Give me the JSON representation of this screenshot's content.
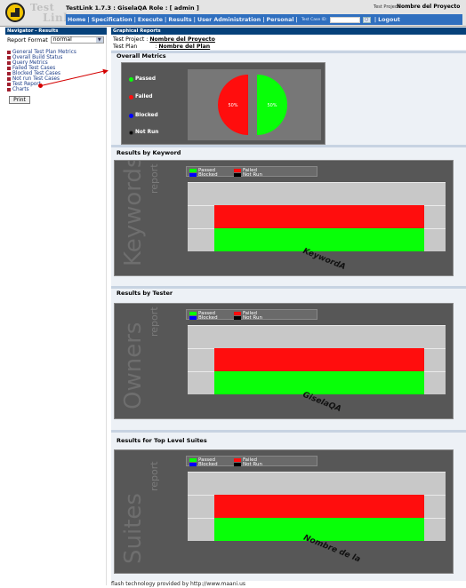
{
  "header": {
    "logo_line1": "Test",
    "logo_line2": "Link",
    "app_title": "TestLink 1.7.3 : GiselaQA Role : [ admin ]",
    "project_label": "Test Project",
    "project_value": "Nombre del Proyecto",
    "menu": [
      "Home",
      "Specification",
      "Execute",
      "Results",
      "User Administration",
      "Personal"
    ],
    "test_case_id_label": "Test Case ID:",
    "logout": "Logout"
  },
  "navigator": {
    "title": "Navigator - Results",
    "report_format_label": "Report Format",
    "report_format_value": "normal",
    "items": [
      "General Test Plan Metrics",
      "Overall Build Status",
      "Query Metrics",
      "Failed Test Cases",
      "Blocked Test Cases",
      "Not run Test Cases",
      "Test Report",
      "Charts"
    ],
    "print_label": "Print"
  },
  "main": {
    "title": "Graphical Reports",
    "test_project_label": "Test Project :",
    "test_project_value": "Nombre del Proyecto",
    "test_plan_label": "Test Plan",
    "test_plan_sep": ":",
    "test_plan_value": "Nombre del Plan",
    "overall_metrics_title": "Overall Metrics",
    "results_by_keyword_title": "Results by Keyword",
    "results_by_tester_title": "Results by Tester",
    "results_by_suite_title": "Results for Top Level Suites",
    "footer": "flash technology provided by http://www.maani.us"
  },
  "colors": {
    "passed": "#08ff08",
    "failed": "#ff0d0d",
    "blocked": "#0000ff",
    "not_run": "#000000",
    "nav_header": "#06417a"
  },
  "chart_data": [
    {
      "type": "pie",
      "legend": [
        "Passed",
        "Failed",
        "Blocked",
        "Not Run"
      ],
      "values": [
        50,
        50,
        0,
        0
      ],
      "labels": [
        "50%",
        "50%"
      ]
    },
    {
      "type": "bar",
      "watermark": "Keywords",
      "watermark_sub": "report",
      "legend": [
        "Passed",
        "Failed",
        "Blocked",
        "Not Run"
      ],
      "categories": [
        "KeywordA"
      ],
      "series": [
        {
          "name": "Passed",
          "values": [
            1
          ]
        },
        {
          "name": "Failed",
          "values": [
            1
          ]
        },
        {
          "name": "Blocked",
          "values": [
            0
          ]
        },
        {
          "name": "Not Run",
          "values": [
            0
          ]
        }
      ],
      "ylim": [
        0,
        3
      ]
    },
    {
      "type": "bar",
      "watermark": "Owners",
      "watermark_sub": "report",
      "legend": [
        "Passed",
        "Failed",
        "Blocked",
        "Not Run"
      ],
      "categories": [
        "GiselaQA"
      ],
      "series": [
        {
          "name": "Passed",
          "values": [
            1
          ]
        },
        {
          "name": "Failed",
          "values": [
            1
          ]
        },
        {
          "name": "Blocked",
          "values": [
            0
          ]
        },
        {
          "name": "Not Run",
          "values": [
            0
          ]
        }
      ],
      "ylim": [
        0,
        3
      ]
    },
    {
      "type": "bar",
      "watermark": "Suites",
      "watermark_sub": "report",
      "legend": [
        "Passed",
        "Failed",
        "Blocked",
        "Not Run"
      ],
      "categories": [
        "Nombre de la"
      ],
      "series": [
        {
          "name": "Passed",
          "values": [
            1
          ]
        },
        {
          "name": "Failed",
          "values": [
            1
          ]
        },
        {
          "name": "Blocked",
          "values": [
            0
          ]
        },
        {
          "name": "Not Run",
          "values": [
            0
          ]
        }
      ],
      "ylim": [
        0,
        3
      ]
    }
  ]
}
